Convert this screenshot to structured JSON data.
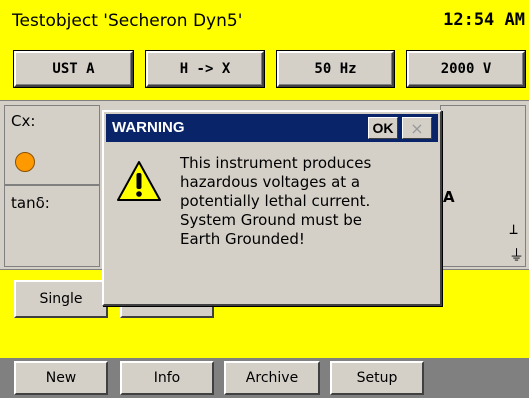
{
  "header": {
    "title": "Testobject 'Secheron Dyn5'",
    "clock": "12:54 AM"
  },
  "top_buttons": [
    {
      "label": "UST A"
    },
    {
      "label": "H -> X"
    },
    {
      "label": "50 Hz"
    },
    {
      "label": "2000 V"
    }
  ],
  "panel": {
    "cx_label": "Cx:",
    "tand_label": "tanδ:",
    "partial_unit": "A",
    "indicator_color": "#ff9900"
  },
  "mid_buttons": {
    "single_label": "Single",
    "second_label": ""
  },
  "footer_buttons": [
    {
      "label": "New"
    },
    {
      "label": "Info"
    },
    {
      "label": "Archive"
    },
    {
      "label": "Setup"
    }
  ],
  "dialog": {
    "title": "WARNING",
    "ok_label": "OK",
    "close_label": "×",
    "message_lines": [
      "This instrument produces",
      "hazardous voltages at a",
      "potentially lethal current.",
      "System Ground must be",
      "Earth Grounded!"
    ],
    "icon": "warning-triangle-icon"
  },
  "colors": {
    "background": "#ffff00",
    "dialog_title_bar": "#0a246a",
    "button_face": "#d4d0c8"
  }
}
